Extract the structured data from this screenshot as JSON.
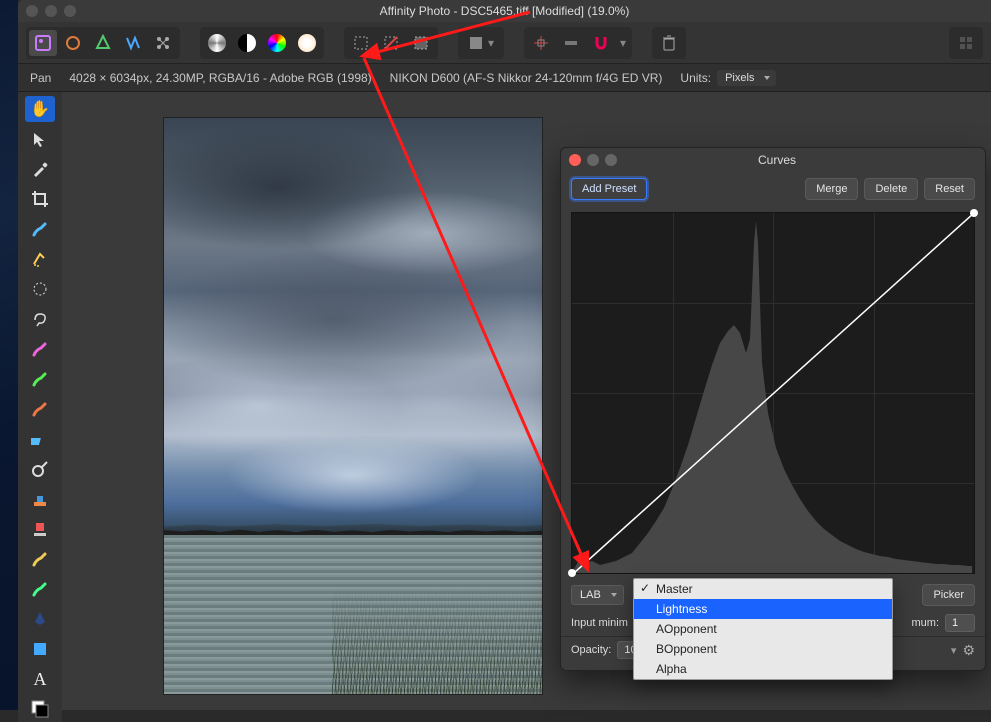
{
  "titlebar": {
    "title": "Affinity Photo - DSC5465.tiff [Modified] (19.0%)"
  },
  "infobar": {
    "tool": "Pan",
    "dims": "4028 × 6034px, 24.30MP, RGBA/16 - Adobe RGB (1998)",
    "camera": "NIKON D600 (AF-S Nikkor 24-120mm f/4G ED VR)",
    "units_label": "Units:",
    "units_value": "Pixels"
  },
  "panel": {
    "title": "Curves",
    "add_preset": "Add Preset",
    "merge": "Merge",
    "delete": "Delete",
    "reset": "Reset",
    "colorspace": "LAB",
    "picker": "Picker",
    "input_min_label": "Input minim",
    "output_max_label": "mum:",
    "output_max_value": "1",
    "opacity_label": "Opacity:",
    "opacity_value": "10"
  },
  "menu": {
    "items": [
      "Master",
      "Lightness",
      "AOpponent",
      "BOpponent",
      "Alpha"
    ],
    "checked": "Master",
    "highlighted": "Lightness"
  }
}
